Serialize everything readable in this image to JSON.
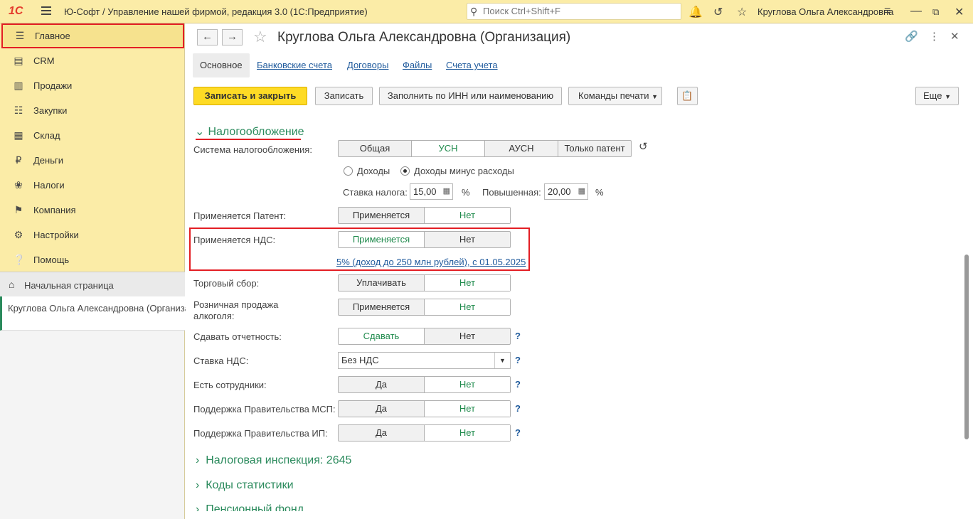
{
  "app": {
    "logo": "1С",
    "title": "Ю-Софт / Управление нашей фирмой, редакция 3.0  (1С:Предприятие)",
    "search_placeholder": "Поиск Ctrl+Shift+F",
    "user": "Круглова Ольга Александровна"
  },
  "sidebar": {
    "items": [
      {
        "label": "Главное",
        "icon": "menu-icon"
      },
      {
        "label": "CRM",
        "icon": "crm-icon"
      },
      {
        "label": "Продажи",
        "icon": "basket-icon"
      },
      {
        "label": "Закупки",
        "icon": "cart-icon"
      },
      {
        "label": "Склад",
        "icon": "grid-icon"
      },
      {
        "label": "Деньги",
        "icon": "ruble-icon"
      },
      {
        "label": "Налоги",
        "icon": "eagle-icon"
      },
      {
        "label": "Компания",
        "icon": "flag-icon"
      },
      {
        "label": "Настройки",
        "icon": "gear-icon"
      },
      {
        "label": "Помощь",
        "icon": "help-icon"
      }
    ]
  },
  "bottomnav": {
    "home": "Начальная страница",
    "current": "Круглова Ольга Александровна (Организация)"
  },
  "form": {
    "title": "Круглова Ольга Александровна (Организация)",
    "tabs": [
      "Основное",
      "Банковские счета",
      "Договоры",
      "Файлы",
      "Счета учета"
    ],
    "buttons": {
      "save_close": "Записать и закрыть",
      "save": "Записать",
      "fill": "Заполнить по ИНН или наименованию",
      "print": "Команды печати",
      "more": "Еще"
    },
    "section_title": "Налогообложение",
    "tax_system_label": "Система налогообложения:",
    "tax_system_options": [
      "Общая",
      "УСН",
      "АУСН",
      "Только патент"
    ],
    "income_options": [
      "Доходы",
      "Доходы минус расходы"
    ],
    "rate_label": "Ставка налога:",
    "rate_value": "15,00",
    "percent": "%",
    "raised_label": "Повышенная:",
    "raised_value": "20,00",
    "patent": {
      "label": "Применяется Патент:",
      "options": [
        "Применяется",
        "Нет"
      ]
    },
    "vat": {
      "label": "Применяется НДС:",
      "options": [
        "Применяется",
        "Нет"
      ],
      "link": "5% (доход до 250 млн рублей), с 01.05.2025"
    },
    "trade_fee": {
      "label": "Торговый сбор:",
      "options": [
        "Уплачивать",
        "Нет"
      ]
    },
    "alcohol": {
      "label": "Розничная продажа алкоголя:",
      "options": [
        "Применяется",
        "Нет"
      ]
    },
    "reporting": {
      "label": "Сдавать отчетность:",
      "options": [
        "Сдавать",
        "Нет"
      ]
    },
    "vat_rate": {
      "label": "Ставка НДС:",
      "value": "Без НДС"
    },
    "employees": {
      "label": "Есть сотрудники:",
      "options": [
        "Да",
        "Нет"
      ]
    },
    "gov_msp": {
      "label": "Поддержка Правительства МСП:",
      "options": [
        "Да",
        "Нет"
      ]
    },
    "gov_ip": {
      "label": "Поддержка Правительства ИП:",
      "options": [
        "Да",
        "Нет"
      ]
    },
    "help": "?",
    "collapsed_sections": [
      "Налоговая инспекция: 2645",
      "Коды статистики",
      "Пенсионный фонд"
    ]
  }
}
